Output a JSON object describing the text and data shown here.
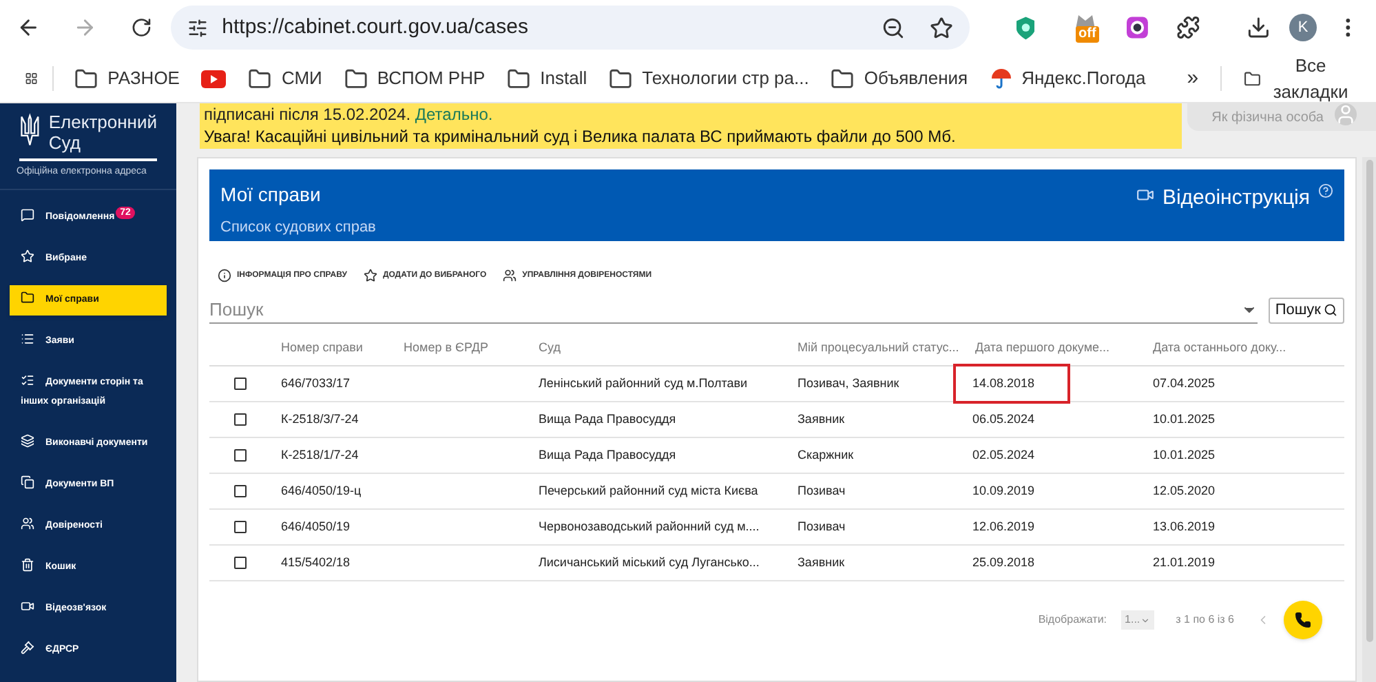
{
  "browser": {
    "url": "https://cabinet.court.gov.ua/cases",
    "profile_initial": "K",
    "extension_badge": "off"
  },
  "bookmarks": [
    {
      "kind": "folder",
      "label": "РАЗНОЕ"
    },
    {
      "kind": "video"
    },
    {
      "kind": "folder",
      "label": "СМИ"
    },
    {
      "kind": "folder",
      "label": "ВСПОМ PHP"
    },
    {
      "kind": "folder",
      "label": "Install"
    },
    {
      "kind": "folder",
      "label": "Технологии стр ра..."
    },
    {
      "kind": "folder",
      "label": "Объявления"
    },
    {
      "kind": "weather",
      "label": "Яндекс.Погода"
    }
  ],
  "bookmarks_more": "»",
  "all_bookmarks": "Все закладки",
  "sidebar": {
    "logo_line1": "Електронний",
    "logo_line2": "Суд",
    "subtitle": "Офіційна електронна адреса",
    "items": [
      {
        "label": "Повідомлення",
        "badge": "72",
        "selected": false
      },
      {
        "label": "Вибране",
        "selected": false
      },
      {
        "label": "Мої справи",
        "selected": true
      },
      {
        "label": "Заяви",
        "selected": false
      },
      {
        "label": "Документи сторін та інших організацій",
        "selected": false
      },
      {
        "label": "Виконавчі документи",
        "selected": false
      },
      {
        "label": "Документи ВП",
        "selected": false
      },
      {
        "label": "Довіреності",
        "selected": false
      },
      {
        "label": "Кошик",
        "selected": false
      },
      {
        "label": "Відеозв'язок",
        "selected": false
      },
      {
        "label": "ЄДРСР",
        "selected": false
      }
    ]
  },
  "banner": {
    "cut_line": "підписані після 15.02.2024.",
    "cut_link": "Детально.",
    "notice": "Увага! Касаційні цивільний та кримінальний суд і Велика палата ВС приймають файли до 500 Мб."
  },
  "user_role": "Як фізична особа",
  "card": {
    "title": "Мої справи",
    "subtitle": "Список судових справ",
    "video_link": "Відеоінструкція"
  },
  "actions": [
    {
      "label": "ІНФОРМАЦІЯ ПРО СПРАВУ"
    },
    {
      "label": "ДОДАТИ ДО ВИБРАНОГО"
    },
    {
      "label": "УПРАВЛІННЯ ДОВІРЕНОСТЯМИ"
    }
  ],
  "search": {
    "placeholder": "Пошук",
    "button": "Пошук"
  },
  "table": {
    "columns": [
      "Номер справи",
      "Номер в ЄРДР",
      "Суд",
      "Мій процесуальний статус...",
      "Дата першого докуме...",
      "Дата останнього доку..."
    ],
    "rows": [
      {
        "checked": false,
        "number": "646/7033/17",
        "court": "Ленінський районний суд м.Полтави",
        "status": "Позивач, Заявник",
        "first": "14.08.2018",
        "last": "07.04.2025",
        "highlighted": true
      },
      {
        "checked": false,
        "number": "К-2518/3/7-24",
        "court": "Вища Рада Правосуддя",
        "status": "Заявник",
        "first": "06.05.2024",
        "last": "10.01.2025",
        "highlighted": false
      },
      {
        "checked": false,
        "number": "К-2518/1/7-24",
        "court": "Вища Рада Правосуддя",
        "status": "Скаржник",
        "first": "02.05.2024",
        "last": "10.01.2025",
        "highlighted": false
      },
      {
        "checked": false,
        "number": "646/4050/19-ц",
        "court": "Печерський районний суд міста Києва",
        "status": "Позивач",
        "first": "10.09.2019",
        "last": "12.05.2020",
        "highlighted": false
      },
      {
        "checked": false,
        "number": "646/4050/19",
        "court": "Червонозаводський районний суд м....",
        "status": "Позивач",
        "first": "12.06.2019",
        "last": "13.06.2019",
        "highlighted": false
      },
      {
        "checked": false,
        "number": "415/5402/18",
        "court": "Лисичанський міський суд Лугансько...",
        "status": "Заявник",
        "first": "25.09.2018",
        "last": "21.01.2019",
        "highlighted": false
      }
    ]
  },
  "pagination": {
    "label": "Відображати:",
    "page_size": "1...",
    "range": "з 1 по 6 із 6"
  }
}
